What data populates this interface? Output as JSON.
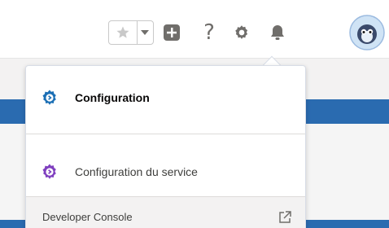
{
  "header": {
    "icons": {
      "favorite": "star-icon",
      "favorites_list": "chevron-down-icon",
      "add": "plus-icon",
      "help": "question-icon",
      "setup": "gear-icon",
      "notifications": "bell-icon",
      "avatar": "avatar"
    },
    "help_glyph": "?"
  },
  "setup_menu": {
    "items": [
      {
        "label": "Configuration",
        "icon": "gear-icon",
        "color": "#1b6fb5"
      },
      {
        "label": "Configuration du service",
        "icon": "gear-icon",
        "color": "#7f3fbf"
      }
    ],
    "developer_console": {
      "label": "Developer Console",
      "icon": "external-link-icon"
    }
  },
  "colors": {
    "brand_blue": "#2a6bb0",
    "setup_blue": "#1b6fb5",
    "service_purple": "#7f3fbf",
    "icon_gray": "#706e6b"
  }
}
